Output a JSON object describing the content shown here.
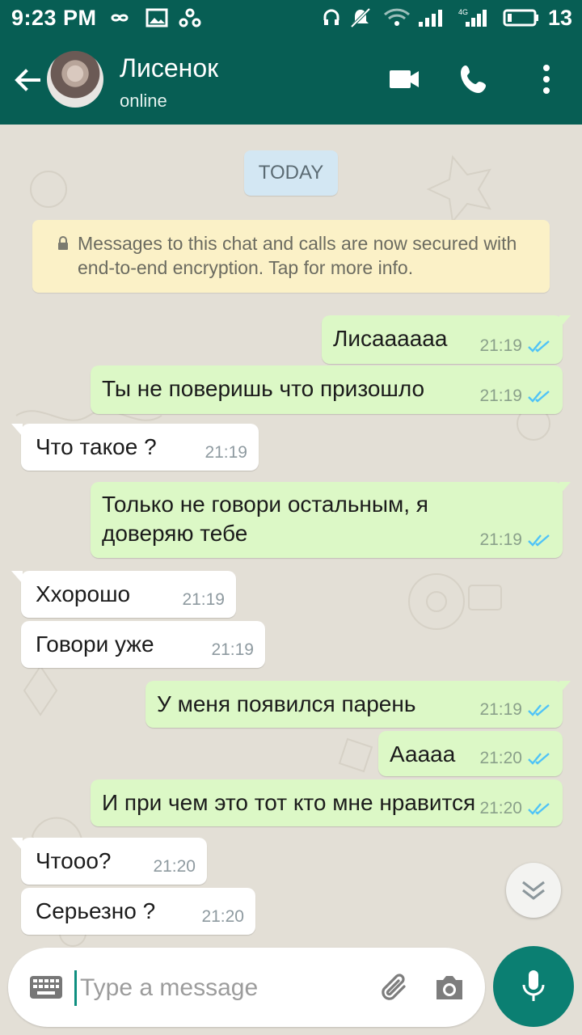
{
  "status_bar": {
    "time": "9:23 PM",
    "battery": "13",
    "network": "4G"
  },
  "header": {
    "contact_name": "Лисенок",
    "contact_status": "online"
  },
  "chat": {
    "date_label": "TODAY",
    "encryption_notice": "Messages to this chat and calls are now secured with end-to-end encryption. Tap for more info.",
    "messages": [
      {
        "dir": "out",
        "text": "Лисааааaa",
        "time": "21:19"
      },
      {
        "dir": "out",
        "text": "Ты не поверишь что призошло",
        "time": "21:19"
      },
      {
        "dir": "in",
        "text": "Что такое ?",
        "time": "21:19"
      },
      {
        "dir": "out",
        "text": "Только не говори остальным, я\nдоверяю тебе",
        "time": "21:19"
      },
      {
        "dir": "in",
        "text": "Ххорошо",
        "time": "21:19"
      },
      {
        "dir": "in",
        "text": "Говори уже",
        "time": "21:19"
      },
      {
        "dir": "out",
        "text": "У меня появился парень",
        "time": "21:19"
      },
      {
        "dir": "out",
        "text": "Ааааа",
        "time": "21:20"
      },
      {
        "dir": "out",
        "text": "И при чем это тот кто мне нравится",
        "time": "21:20"
      },
      {
        "dir": "in",
        "text": "Чтооо?",
        "time": "21:20"
      },
      {
        "dir": "in",
        "text": "Серьезно ?",
        "time": "21:20"
      }
    ]
  },
  "composer": {
    "placeholder": "Type a message"
  },
  "colors": {
    "header": "#075e54",
    "outgoing_bubble": "#dcf8c6",
    "incoming_bubble": "#ffffff",
    "read_tick": "#4fc3f7",
    "mic_button": "#0b7f72"
  }
}
